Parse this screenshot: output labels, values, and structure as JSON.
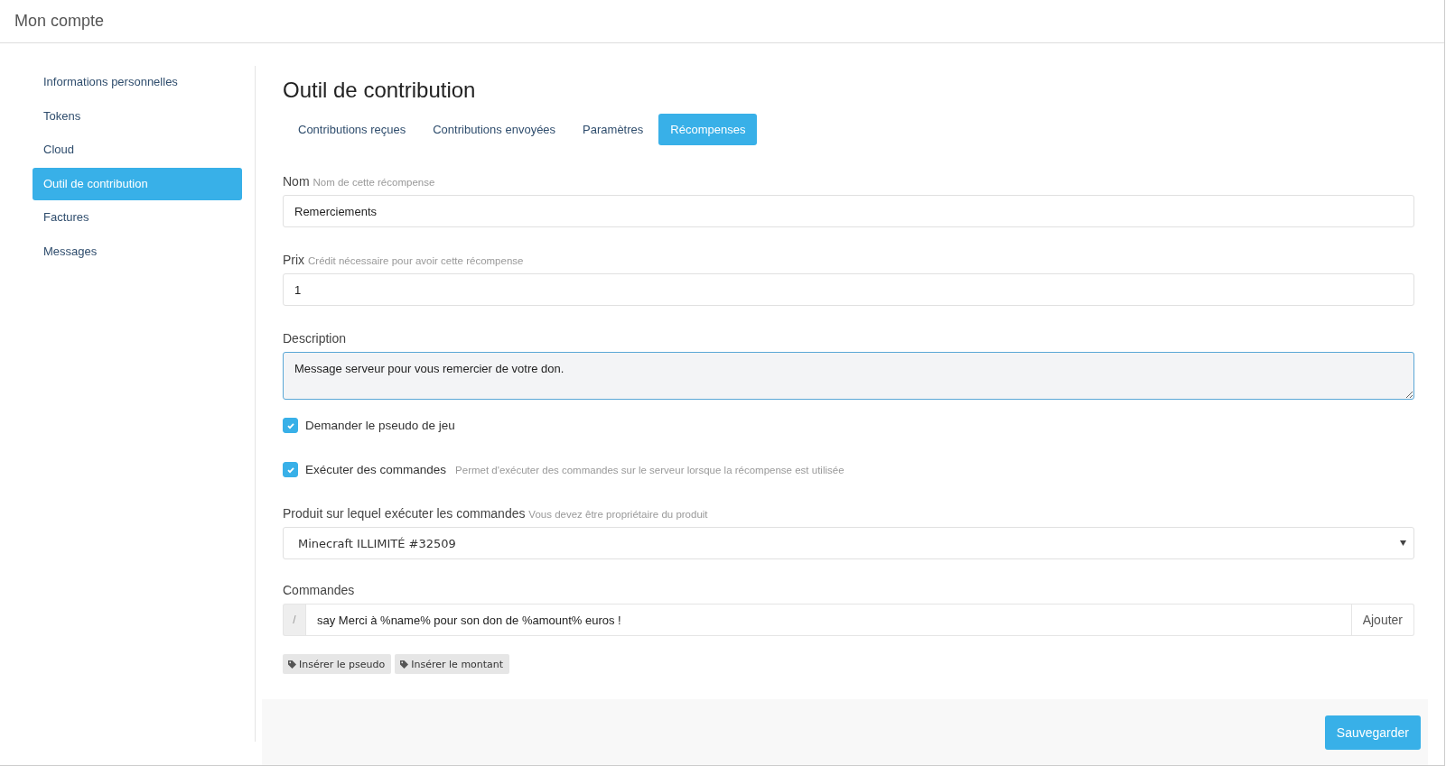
{
  "header": {
    "title": "Mon compte"
  },
  "sidebar": {
    "items": [
      {
        "label": "Informations personnelles",
        "selected": false
      },
      {
        "label": "Tokens",
        "selected": false
      },
      {
        "label": "Cloud",
        "selected": false
      },
      {
        "label": "Outil de contribution",
        "selected": true
      },
      {
        "label": "Factures",
        "selected": false
      },
      {
        "label": "Messages",
        "selected": false
      }
    ]
  },
  "content": {
    "title": "Outil de contribution",
    "tabs": [
      {
        "label": "Contributions reçues",
        "selected": false
      },
      {
        "label": "Contributions envoyées",
        "selected": false
      },
      {
        "label": "Paramètres",
        "selected": false
      },
      {
        "label": "Récompenses",
        "selected": true
      }
    ],
    "fields": [
      {
        "kind": "text",
        "label": "Nom",
        "hint": "Nom de cette récompense",
        "value": "Remerciements"
      },
      {
        "kind": "text",
        "label": "Prix",
        "hint": "Crédit nécessaire pour avoir cette récompense",
        "value": "1"
      },
      {
        "kind": "textarea",
        "label": "Description",
        "value": "Message serveur pour vous remercier de votre don.",
        "focused": true
      },
      {
        "kind": "checkbox",
        "label": "Demander le pseudo de jeu",
        "checked": true
      },
      {
        "kind": "checkbox",
        "label": "Exécuter des commandes",
        "hint": "Permet d'exécuter des commandes sur le serveur lorsque la récompense est utilisée",
        "checked": true
      },
      {
        "kind": "select",
        "label": "Produit sur lequel exécuter les commandes",
        "hint": "Vous devez être propriétaire du produit",
        "value": "Minecraft ILLIMITÉ #32509"
      },
      {
        "kind": "command",
        "label": "Commandes",
        "prefix": "/",
        "value": "say Merci à %name% pour son don de %amount% euros !",
        "button": "Ajouter",
        "tags": [
          "Insérer le pseudo",
          "Insérer le montant"
        ]
      }
    ],
    "save_button": "Sauvegarder"
  }
}
